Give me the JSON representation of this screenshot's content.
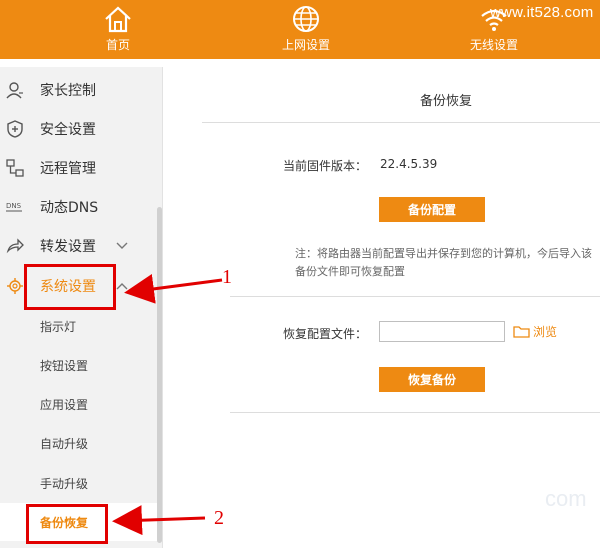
{
  "watermark": "www.it528.com",
  "nav": [
    {
      "label": "首页",
      "icon": "home-icon"
    },
    {
      "label": "上网设置",
      "icon": "globe-icon"
    },
    {
      "label": "无线设置",
      "icon": "wifi-icon"
    }
  ],
  "sidebar": {
    "items": [
      {
        "label": "家长控制",
        "icon": "user-icon"
      },
      {
        "label": "安全设置",
        "icon": "shield-icon"
      },
      {
        "label": "远程管理",
        "icon": "remote-icon"
      },
      {
        "label": "动态DNS",
        "icon": "dns-icon"
      },
      {
        "label": "转发设置",
        "icon": "forward-icon"
      },
      {
        "label": "系统设置",
        "icon": "gear-icon"
      }
    ],
    "sub_items": [
      {
        "label": "指示灯"
      },
      {
        "label": "按钮设置"
      },
      {
        "label": "应用设置"
      },
      {
        "label": "自动升级"
      },
      {
        "label": "手动升级"
      },
      {
        "label": "备份恢复"
      }
    ],
    "dns_icon_text": "DNS"
  },
  "main": {
    "title": "备份恢复",
    "firmware_label": "当前固件版本：",
    "firmware_version": "22.4.5.39",
    "backup_button": "备份配置",
    "note": "注：将路由器当前配置导出并保存到您的计算机，今后导入该备份文件即可恢复配置",
    "restore_label": "恢复配置文件：",
    "restore_file_value": "",
    "browse_label": "浏览",
    "restore_button": "恢复备份"
  },
  "annotations": {
    "label_1": "1",
    "label_2": "2",
    "color": "#e10000"
  },
  "faint_watermark": "com",
  "colors": {
    "accent": "#ee8a12",
    "sidebar_bg": "#f2f2f2"
  }
}
